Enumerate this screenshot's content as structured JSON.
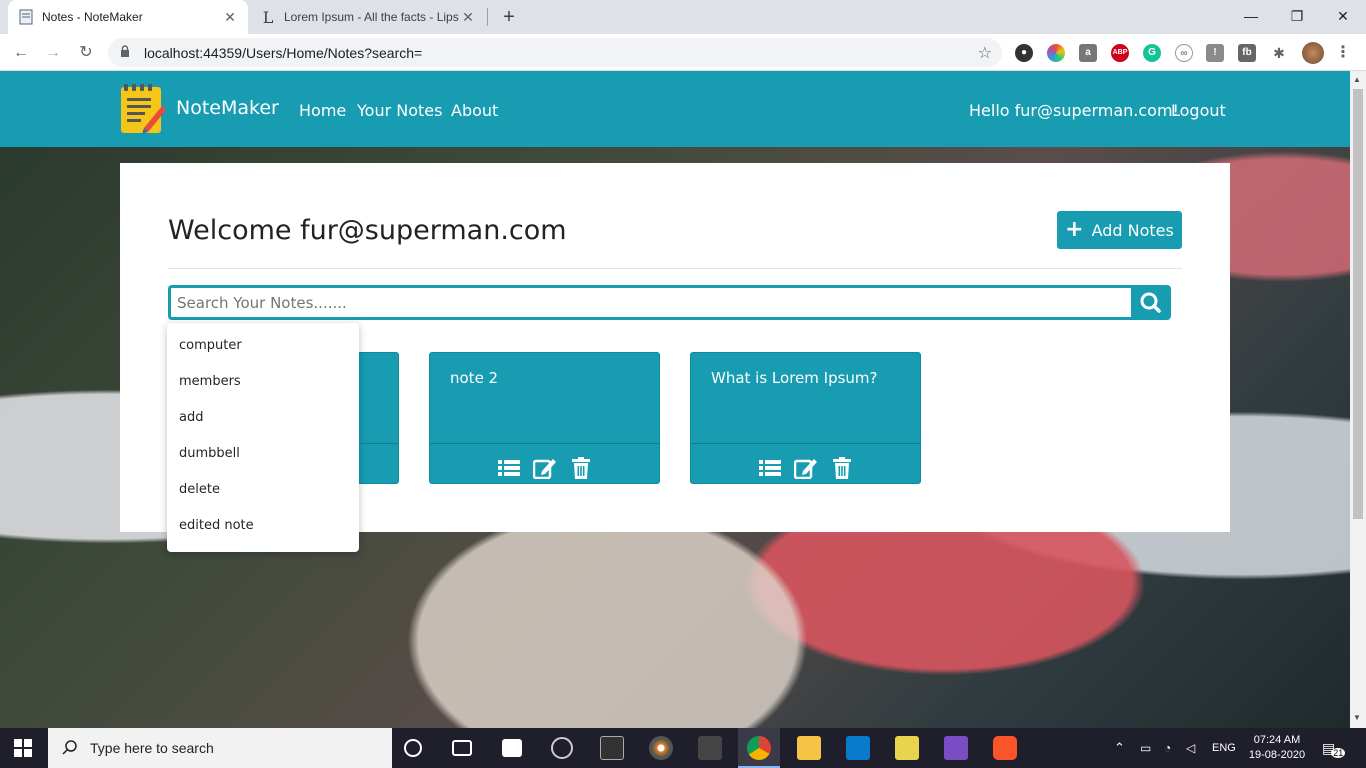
{
  "browser": {
    "tabs": [
      {
        "title": "Notes - NoteMaker"
      },
      {
        "title": "Lorem Ipsum - All the facts - Lips"
      }
    ],
    "url": "localhost:44359/Users/Home/Notes?search="
  },
  "navbar": {
    "brand": "NoteMaker",
    "links": [
      "Home",
      "Your Notes",
      "About"
    ],
    "greeting": "Hello fur@superman.com!",
    "logout": "Logout"
  },
  "main": {
    "welcome": "Welcome fur@superman.com",
    "add_button": "Add Notes",
    "search_placeholder": "Search Your Notes.......",
    "suggestions": [
      "computer",
      "members",
      "add",
      "dumbbell",
      "delete",
      "edited note"
    ],
    "notes": [
      {
        "title": ""
      },
      {
        "title": "note 2"
      },
      {
        "title": "What is Lorem Ipsum?"
      }
    ]
  },
  "taskbar": {
    "search_placeholder": "Type here to search",
    "language": "ENG",
    "time": "07:24 AM",
    "date": "19-08-2020",
    "notifications": "21"
  },
  "colors": {
    "accent": "#179cb2"
  }
}
